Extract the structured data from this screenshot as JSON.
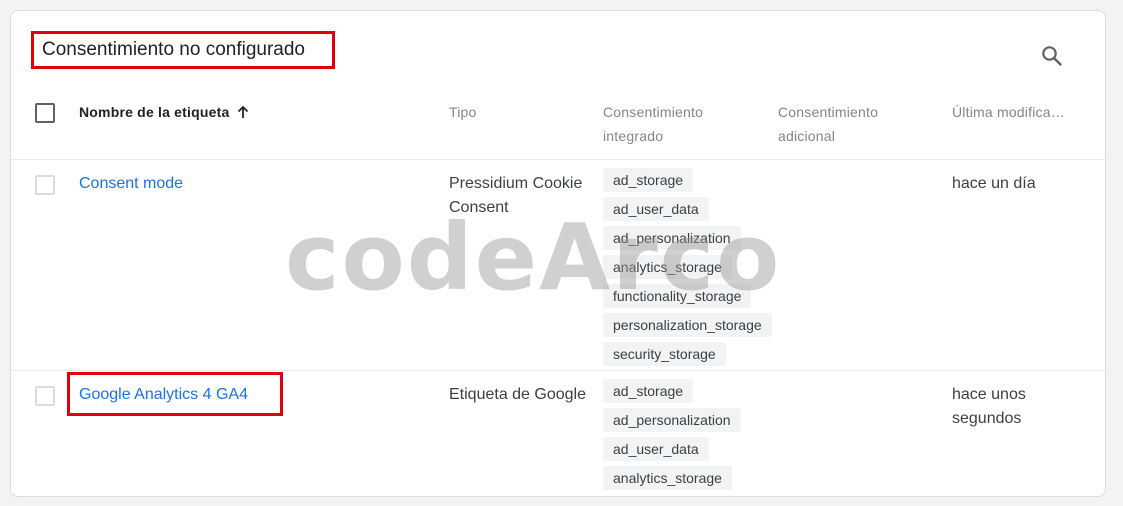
{
  "panel": {
    "title": "Consentimiento no configurado",
    "search_icon": "search-icon"
  },
  "table": {
    "headers": {
      "name": "Nombre de la etiqueta",
      "sort_icon": "arrow-up-icon",
      "type": "Tipo",
      "builtin_consent": [
        "Consentimiento",
        "integrado"
      ],
      "additional_consent": [
        "Consentimiento",
        "adicional"
      ],
      "last_modified": "Última modifica…"
    },
    "rows": [
      {
        "name": "Consent mode",
        "type": [
          "Pressidium Cookie",
          "Consent"
        ],
        "builtin_consent": [
          "ad_storage",
          "ad_user_data",
          "ad_personalization",
          "analytics_storage",
          "functionality_storage",
          "personalization_storage",
          "security_storage"
        ],
        "additional_consent": [],
        "last_modified": [
          "hace un día"
        ]
      },
      {
        "name": "Google Analytics 4 GA4",
        "type": [
          "Etiqueta de Google"
        ],
        "builtin_consent": [
          "ad_storage",
          "ad_personalization",
          "ad_user_data",
          "analytics_storage"
        ],
        "additional_consent": [],
        "last_modified": [
          "hace unos",
          "segundos"
        ]
      }
    ]
  },
  "watermark": "codeArco",
  "colors": {
    "link": "#1a73e8",
    "highlight": "#e0000b"
  }
}
